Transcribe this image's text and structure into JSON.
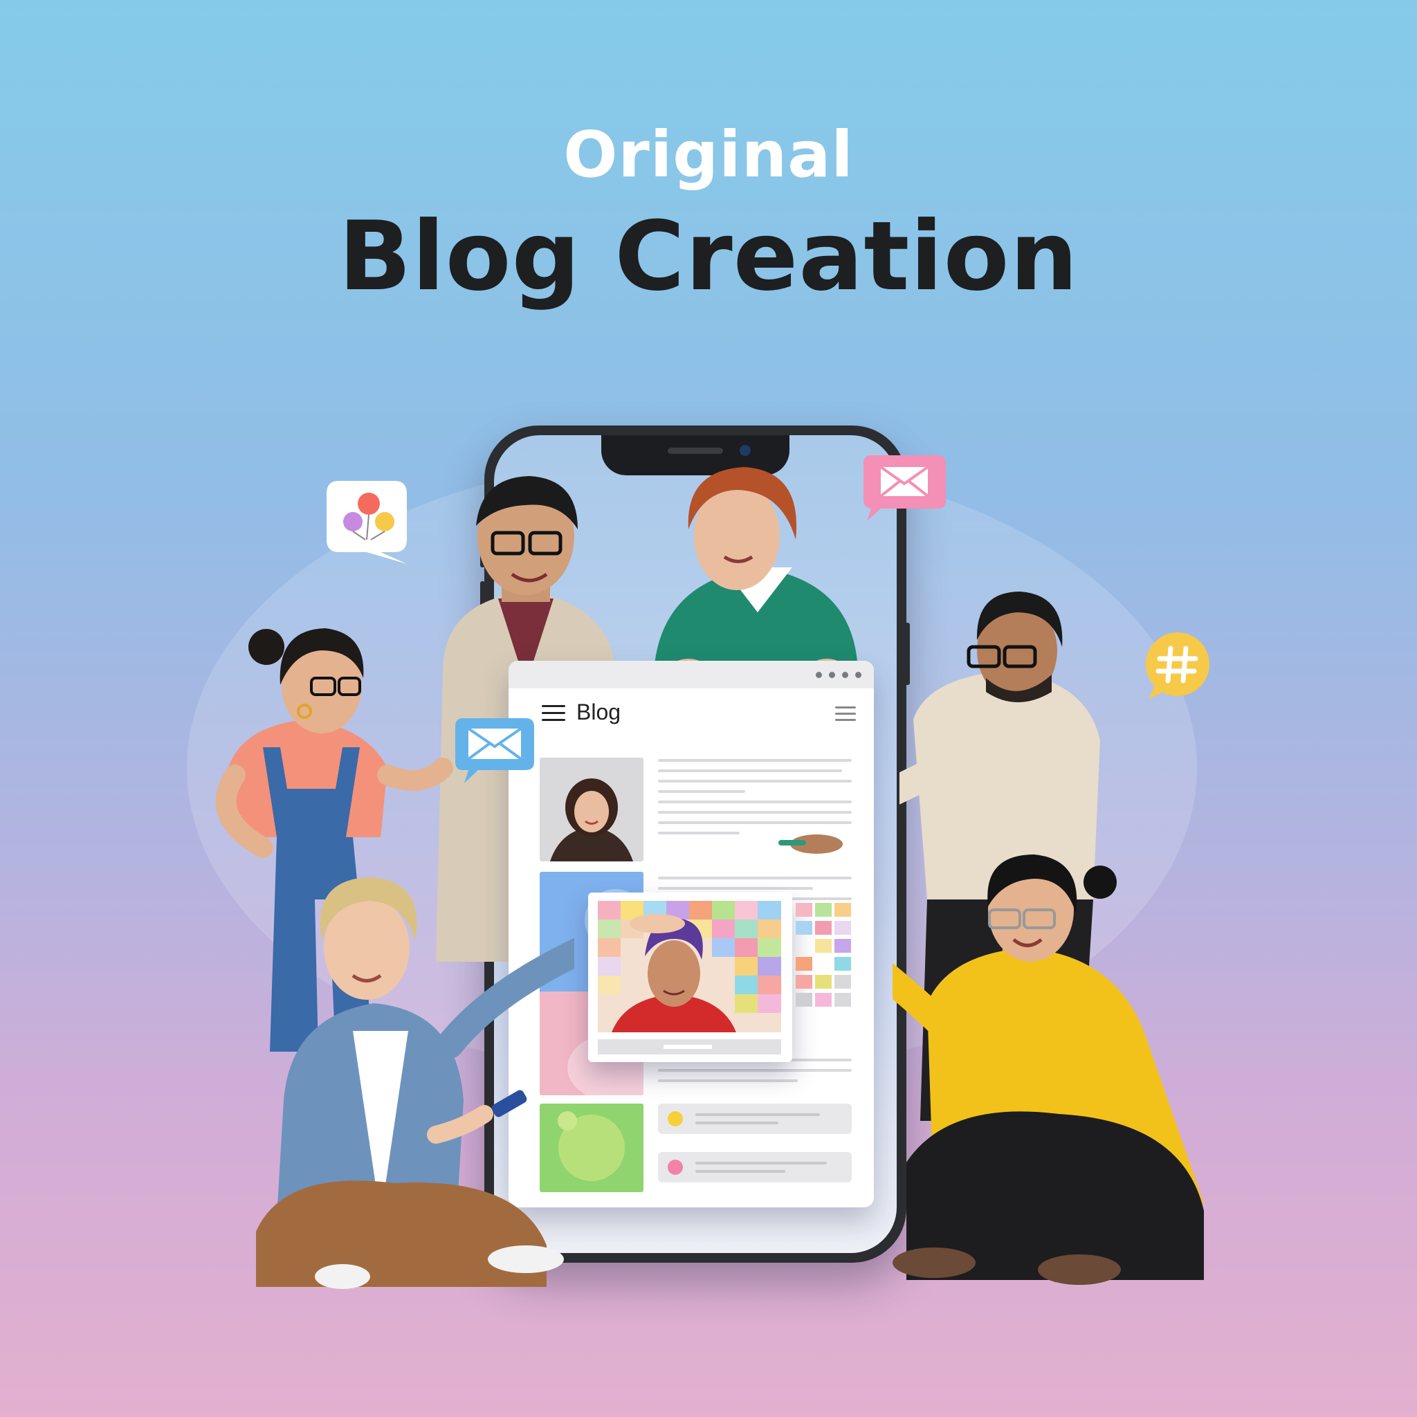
{
  "header": {
    "eyebrow": "Original",
    "title": "Blog Creation"
  },
  "phone_screen": {
    "app_label": "Blog"
  },
  "bubbles": [
    {
      "icon": "balloons-icon",
      "color": "#ffffff"
    },
    {
      "icon": "envelope-icon",
      "color": "#f48fb5"
    },
    {
      "icon": "envelope-icon",
      "color": "#63b3ea"
    },
    {
      "icon": "hashtag-icon",
      "color": "#f7c948"
    }
  ],
  "colors": {
    "bg_top": "#85cbe9",
    "bg_bottom": "#e3b0cf",
    "title_dark": "#1d1f21",
    "eyebrow": "#ffffff"
  }
}
